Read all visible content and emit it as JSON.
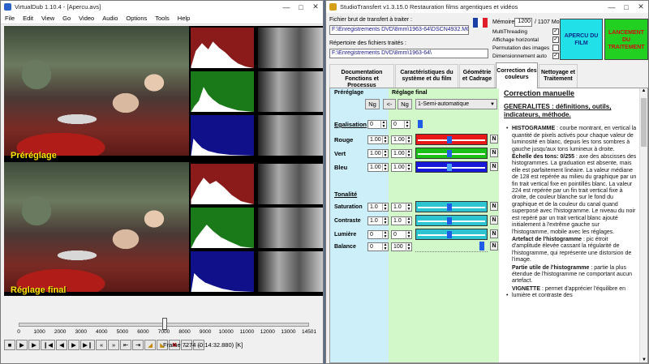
{
  "vdub": {
    "title": "VirtualDub 1.10.4 - [Apercu.avs]",
    "menu": [
      "File",
      "Edit",
      "View",
      "Go",
      "Video",
      "Audio",
      "Options",
      "Tools",
      "Help"
    ],
    "label_top": "Préréglage",
    "label_bottom": "Réglage final",
    "ticks": [
      "0",
      "1000",
      "2000",
      "3000",
      "4000",
      "5000",
      "6000",
      "7000",
      "8000",
      "9000",
      "10000",
      "11000",
      "12000",
      "13000",
      "14501"
    ],
    "position_fraction": 0.502,
    "frame_status": "Frame 7274 (0:14:32.880) [K]"
  },
  "st": {
    "title": "StudioTransfert v1.3.15.0 Restauration films argentiques et vidéos",
    "file_label": "Fichier brut de transfert à traiter :",
    "file_value": "F:\\Enregistrements DVD\\8mm\\1963-64\\DSCN4932.MOV",
    "dir_label": "Répertoire des fichiers traités :",
    "dir_value": "F:\\Enregistrements DVD\\8mm\\1963-64\\",
    "memory_label": "Mémoire",
    "memory_value": "1200",
    "memory_total": "/ 1107 Mo",
    "options": [
      {
        "label": "MultiThreading",
        "checked": true
      },
      {
        "label": "Affichage horizontal",
        "checked": true
      },
      {
        "label": "Permutation des images",
        "checked": false
      },
      {
        "label": "Dimensionnement auto",
        "checked": true
      }
    ],
    "apercu": "APERCU DU FILM",
    "lancement": "LANCEMENT DU TRAITEMENT",
    "tabs": [
      "Documentation Fonctions et Processus",
      "Caractéristiques du système et du film",
      "Géométrie et Cadrage",
      "Correction des couleurs",
      "Nettoyage et Traitement"
    ],
    "prereglage": "Préréglage",
    "reglage_final": "Réglage final",
    "ng": "Ng",
    "arrow": "<-",
    "mode": "1-Semi-automatique",
    "egal": "Egalisation",
    "egal_v1": "0",
    "egal_v2": "0",
    "rouge": "Rouge",
    "vert": "Vert",
    "bleu": "Bleu",
    "v100": "1.00",
    "tonalite": "Tonalité",
    "saturation": "Saturation",
    "contraste": "Contraste",
    "lumiere": "Lumière",
    "balance": "Balance",
    "v10": "1.0",
    "v0": "0",
    "v100b": "100",
    "n": "N",
    "doc": {
      "h1": "Correction manuelle",
      "h2": "GENERALITES : définitions, outils, indicateurs, méthode.",
      "b1_title": "HISTOGRAMME",
      "b1": " : courbe montrant, en vertical la quantité de pixels activés pour chaque valeur de luminosité en blanc, depuis les tons sombres à gauche jusqu'aux tons lumineux à droite.",
      "p2_title": "Échelle des tons: 0/255",
      "p2": " : axe des abscisses des histogrammes. La graduation est absente, mais elle est parfaitement linéaire. La valeur médiane de 128 est repérée au milieu du graphique par un fin trait vertical fixe en pointillés blanc. La valeur 224 est repérée par un fin trait vertical fixe à droite, de couleur blanche sur le fond du graphique et de la couleur du canal quand superposé avec l'histogramme. Le niveau du noir est repéré par un trait vertical blanc ajouté initialement à l'extrême gauche sur l'histogramme, mobile avec les réglages.",
      "p3_title": "Artefact de l'histogramme",
      "p3": " : pic étroit d'amplitude élevée cassant la régularité de l'histogramme, qui représente une distorsion de l'image.",
      "p4_title": "Partie utile de l'histogramme",
      "p4": " : partie la plus étendue de l'histogramme ne comportant aucun artefact.",
      "b2_title": "VIGNETTE",
      "b2": " : permet d'apprécier l'équilibre en lumière et contraste des"
    }
  }
}
